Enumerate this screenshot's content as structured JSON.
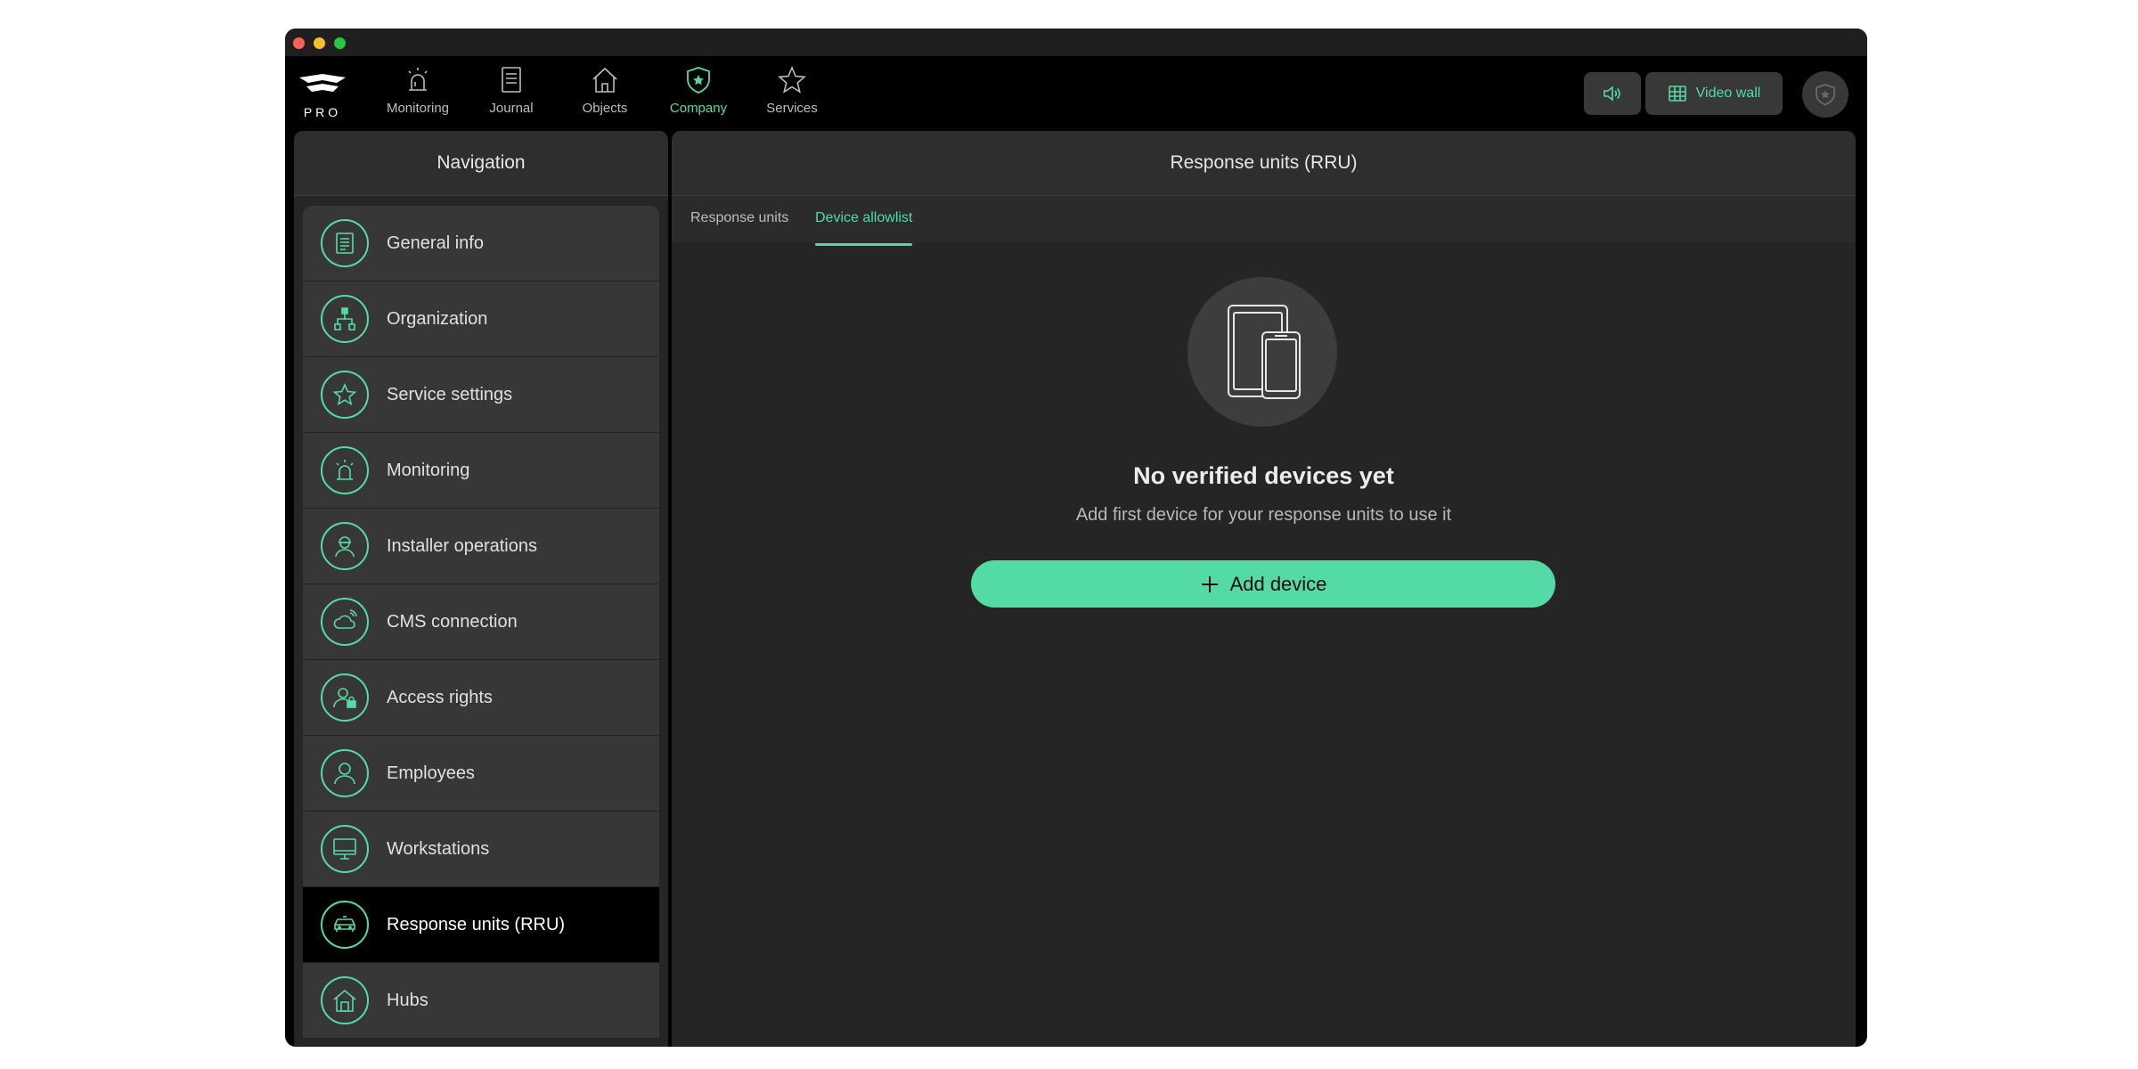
{
  "topnav": {
    "logo_text": "PRO",
    "tabs": [
      {
        "label": "Monitoring",
        "icon": "siren-icon"
      },
      {
        "label": "Journal",
        "icon": "journal-icon"
      },
      {
        "label": "Objects",
        "icon": "house-icon"
      },
      {
        "label": "Company",
        "icon": "shield-star-icon",
        "active": true
      },
      {
        "label": "Services",
        "icon": "star-icon"
      }
    ],
    "video_wall_label": "Video wall"
  },
  "sidebar": {
    "title": "Navigation",
    "items": [
      {
        "label": "General info",
        "icon": "document-icon"
      },
      {
        "label": "Organization",
        "icon": "org-chart-icon"
      },
      {
        "label": "Service settings",
        "icon": "star-icon"
      },
      {
        "label": "Monitoring",
        "icon": "siren-icon"
      },
      {
        "label": "Installer operations",
        "icon": "installer-icon"
      },
      {
        "label": "CMS connection",
        "icon": "cloud-icon"
      },
      {
        "label": "Access rights",
        "icon": "user-lock-icon"
      },
      {
        "label": "Employees",
        "icon": "user-icon"
      },
      {
        "label": "Workstations",
        "icon": "monitor-icon"
      },
      {
        "label": "Response units (RRU)",
        "icon": "car-icon",
        "active": true
      },
      {
        "label": "Hubs",
        "icon": "hub-house-icon"
      }
    ]
  },
  "main": {
    "title": "Response units (RRU)",
    "tabs": [
      {
        "label": "Response units"
      },
      {
        "label": "Device allowlist",
        "active": true
      }
    ],
    "empty_title": "No verified devices yet",
    "empty_subtitle": "Add first device for your response units to use it",
    "add_button_label": "Add device"
  },
  "colors": {
    "accent": "#54dba5",
    "background": "#000000",
    "panel": "#262626",
    "item": "#373737"
  }
}
